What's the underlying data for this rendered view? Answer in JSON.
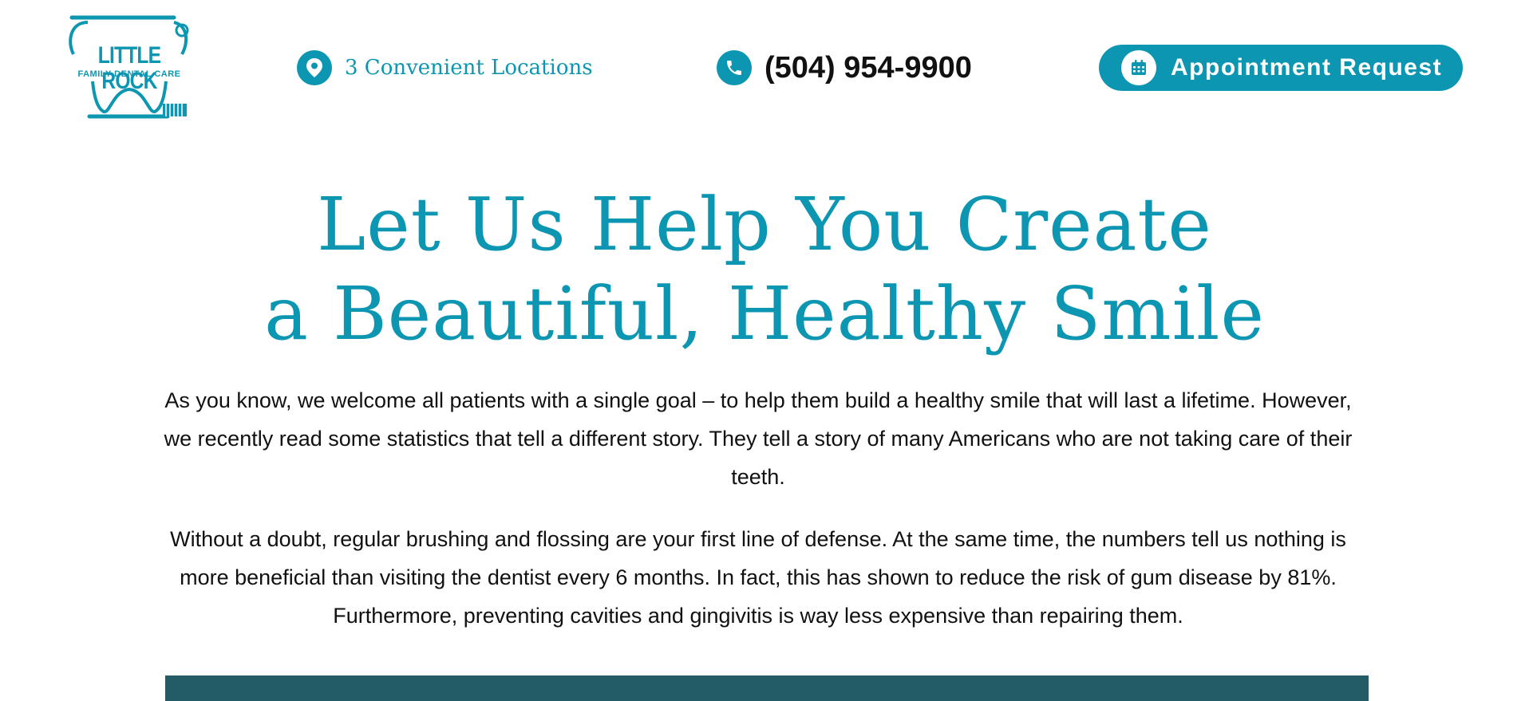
{
  "brand": {
    "name_line1": "LITTLE ROCK",
    "name_line2": "FAMILY DENTAL CARE"
  },
  "header": {
    "locations_label": "3 Convenient Locations",
    "phone": "(504) 954-9900",
    "appointment_label": "Appointment Request"
  },
  "main": {
    "headline_line1": "Let Us Help You Create",
    "headline_line2": "a Beautiful, Healthy Smile",
    "paragraph1": "As you know, we welcome all patients with a single goal – to help them build a healthy smile that will last a lifetime. However, we recently read some statistics that tell a different story. They tell a story of many Americans who are not taking care of their teeth.",
    "paragraph2": "Without a doubt, regular brushing and flossing are your first line of defense. At the same time, the numbers tell us nothing is more beneficial than visiting the dentist every 6 months. In fact, this has shown to reduce the risk of gum disease by 81%. Furthermore, preventing cavities and gingivitis is way less expensive than repairing them."
  },
  "icons": {
    "location": "map-pin-icon",
    "phone": "phone-icon",
    "appointment": "calendar-icon"
  },
  "colors": {
    "accent": "#0d96b2",
    "dark_teal": "#235b66",
    "text": "#111111",
    "background": "#ffffff"
  }
}
